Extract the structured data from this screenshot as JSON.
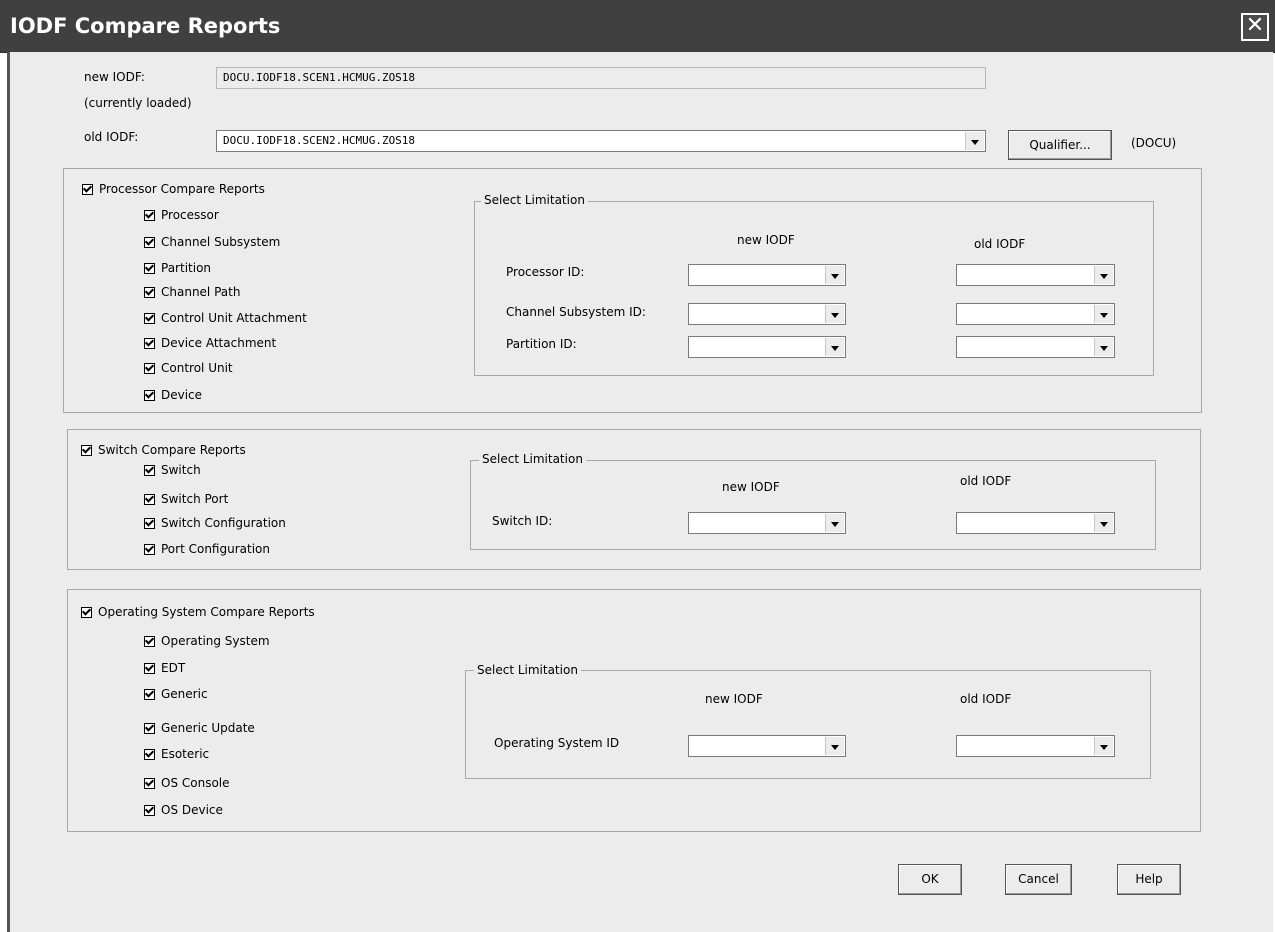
{
  "window": {
    "title": "IODF Compare Reports",
    "close_glyph": "✕"
  },
  "top": {
    "new_iodf_label": "new IODF:",
    "currently_loaded_label": "(currently loaded)",
    "new_iodf_value": "DOCU.IODF18.SCEN1.HCMUG.ZOS18",
    "old_iodf_label": "old IODF:",
    "old_iodf_value": "DOCU.IODF18.SCEN2.HCMUG.ZOS18",
    "qualifier_button": "Qualifier...",
    "qualifier_value": "(DOCU)"
  },
  "processor": {
    "group_label": "Processor Compare Reports",
    "items": [
      "Processor",
      "Channel Subsystem",
      "Partition",
      "Channel Path",
      "Control Unit Attachment",
      "Device Attachment",
      "Control Unit",
      "Device"
    ],
    "limitation": {
      "legend": "Select Limitation",
      "new_header": "new IODF",
      "old_header": "old IODF",
      "fields": [
        "Processor ID:",
        "Channel Subsystem ID:",
        "Partition ID:"
      ]
    }
  },
  "switch": {
    "group_label": "Switch Compare Reports",
    "items": [
      "Switch",
      "Switch Port",
      "Switch Configuration",
      "Port Configuration"
    ],
    "limitation": {
      "legend": "Select Limitation",
      "new_header": "new IODF",
      "old_header": "old IODF",
      "fields": [
        "Switch ID:"
      ]
    }
  },
  "os": {
    "group_label": "Operating System Compare Reports",
    "items": [
      "Operating System",
      "EDT",
      "Generic",
      "Generic Update",
      "Esoteric",
      "OS Console",
      "OS Device"
    ],
    "limitation": {
      "legend": "Select Limitation",
      "new_header": "new IODF",
      "old_header": "old IODF",
      "fields": [
        "Operating System ID"
      ]
    }
  },
  "buttons": {
    "ok": "OK",
    "cancel": "Cancel",
    "help": "Help"
  }
}
